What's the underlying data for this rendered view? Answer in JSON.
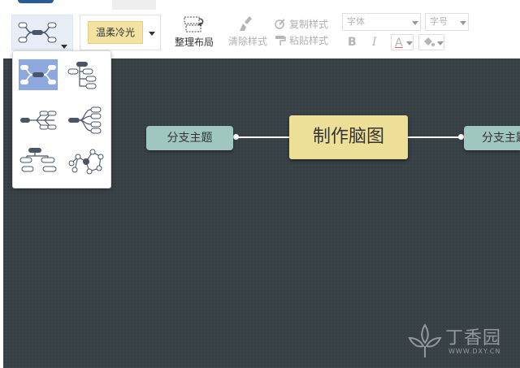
{
  "toolbar": {
    "theme_label": "温柔冷光",
    "arrange_layout": "整理布局",
    "clear_style": "清除样式",
    "copy_style": "复制样式",
    "paste_style": "粘贴样式",
    "font_family_placeholder": "字体",
    "font_size_placeholder": "字号",
    "bold": "B",
    "italic": "I",
    "font_color": "A"
  },
  "layout_menu": {
    "options": [
      {
        "name": "mind-map-both-sides",
        "selected": true
      },
      {
        "name": "org-tree-right",
        "selected": false
      },
      {
        "name": "fishbone",
        "selected": false
      },
      {
        "name": "radial-right",
        "selected": false
      },
      {
        "name": "org-chart-down",
        "selected": false
      },
      {
        "name": "free-network",
        "selected": false
      }
    ]
  },
  "mindmap": {
    "central_topic": "制作脑图",
    "left_branch": "分支主题",
    "right_branch": "分支主题"
  },
  "watermark": {
    "name": "丁香园",
    "url": "WWW.DXY.CN"
  },
  "colors": {
    "canvas_bg": "#3a4347",
    "central_fill": "#eedf98",
    "branch_fill": "#9fc6bf",
    "theme_swatch": "#f2e3a3",
    "selected_layout": "#8da8de"
  }
}
